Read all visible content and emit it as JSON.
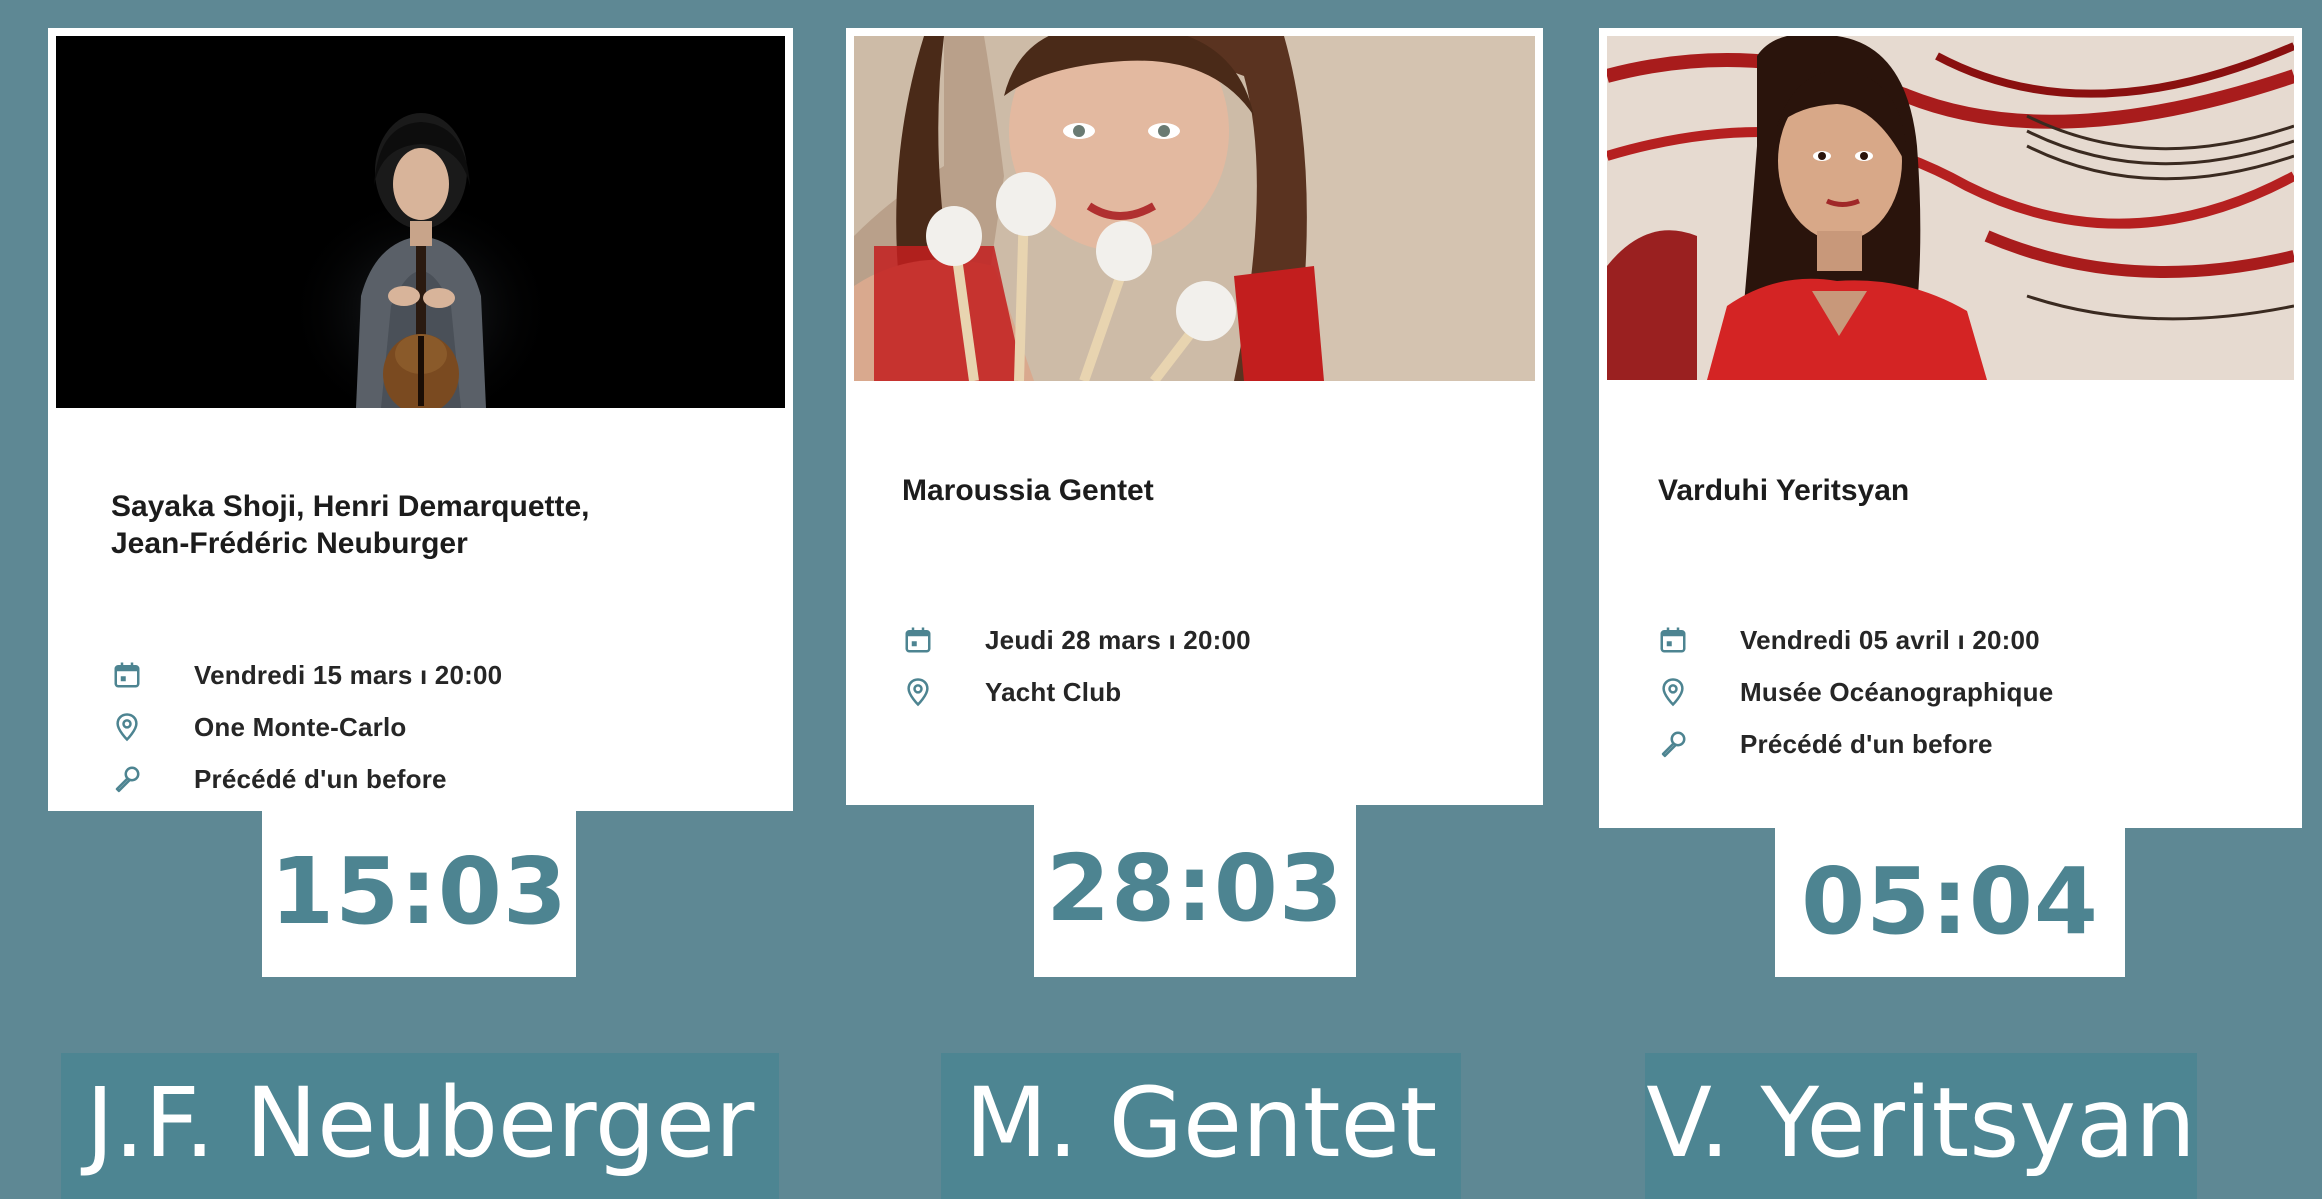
{
  "events": [
    {
      "performer": "Sayaka Shoji, Henri Demarquette,\nJean-Frédéric Neuburger",
      "date": "Vendredi 15 mars ı 20:00",
      "venue": "One Monte-Carlo",
      "extra": "Précédé d'un before",
      "date_short": "15:03",
      "short_name": "J.F. Neuberger"
    },
    {
      "performer": "Maroussia Gentet",
      "date": "Jeudi 28 mars ı 20:00",
      "venue": "Yacht Club",
      "date_short": "28:03",
      "short_name": "M. Gentet"
    },
    {
      "performer": "Varduhi Yeritsyan",
      "date": "Vendredi 05 avril ı 20:00",
      "venue": "Musée Océanographique",
      "extra": "Précédé d'un before",
      "date_short": "05:04",
      "short_name": "V. Yeritsyan"
    }
  ],
  "icons": {
    "date": "calendar-icon",
    "venue": "location-pin-icon",
    "extra": "microphone-icon"
  },
  "colors": {
    "background": "#5e8894",
    "accent": "#4d8491",
    "name_box": "#4d8592"
  }
}
